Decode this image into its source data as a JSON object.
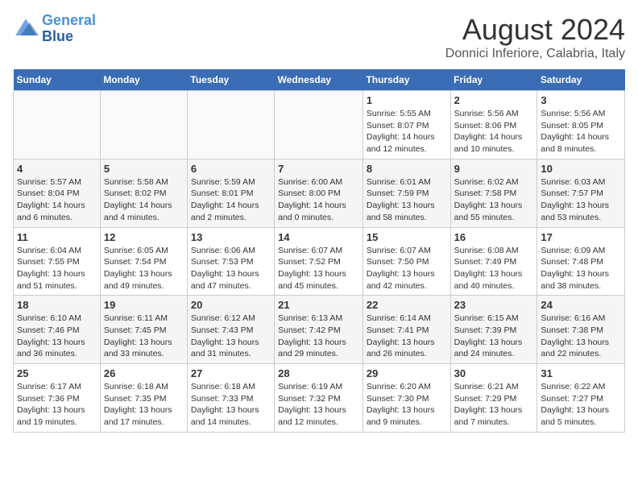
{
  "header": {
    "logo_line1": "General",
    "logo_line2": "Blue",
    "month_title": "August 2024",
    "location": "Donnici Inferiore, Calabria, Italy"
  },
  "weekdays": [
    "Sunday",
    "Monday",
    "Tuesday",
    "Wednesday",
    "Thursday",
    "Friday",
    "Saturday"
  ],
  "weeks": [
    [
      {
        "day": "",
        "info": ""
      },
      {
        "day": "",
        "info": ""
      },
      {
        "day": "",
        "info": ""
      },
      {
        "day": "",
        "info": ""
      },
      {
        "day": "1",
        "info": "Sunrise: 5:55 AM\nSunset: 8:07 PM\nDaylight: 14 hours\nand 12 minutes."
      },
      {
        "day": "2",
        "info": "Sunrise: 5:56 AM\nSunset: 8:06 PM\nDaylight: 14 hours\nand 10 minutes."
      },
      {
        "day": "3",
        "info": "Sunrise: 5:56 AM\nSunset: 8:05 PM\nDaylight: 14 hours\nand 8 minutes."
      }
    ],
    [
      {
        "day": "4",
        "info": "Sunrise: 5:57 AM\nSunset: 8:04 PM\nDaylight: 14 hours\nand 6 minutes."
      },
      {
        "day": "5",
        "info": "Sunrise: 5:58 AM\nSunset: 8:02 PM\nDaylight: 14 hours\nand 4 minutes."
      },
      {
        "day": "6",
        "info": "Sunrise: 5:59 AM\nSunset: 8:01 PM\nDaylight: 14 hours\nand 2 minutes."
      },
      {
        "day": "7",
        "info": "Sunrise: 6:00 AM\nSunset: 8:00 PM\nDaylight: 14 hours\nand 0 minutes."
      },
      {
        "day": "8",
        "info": "Sunrise: 6:01 AM\nSunset: 7:59 PM\nDaylight: 13 hours\nand 58 minutes."
      },
      {
        "day": "9",
        "info": "Sunrise: 6:02 AM\nSunset: 7:58 PM\nDaylight: 13 hours\nand 55 minutes."
      },
      {
        "day": "10",
        "info": "Sunrise: 6:03 AM\nSunset: 7:57 PM\nDaylight: 13 hours\nand 53 minutes."
      }
    ],
    [
      {
        "day": "11",
        "info": "Sunrise: 6:04 AM\nSunset: 7:55 PM\nDaylight: 13 hours\nand 51 minutes."
      },
      {
        "day": "12",
        "info": "Sunrise: 6:05 AM\nSunset: 7:54 PM\nDaylight: 13 hours\nand 49 minutes."
      },
      {
        "day": "13",
        "info": "Sunrise: 6:06 AM\nSunset: 7:53 PM\nDaylight: 13 hours\nand 47 minutes."
      },
      {
        "day": "14",
        "info": "Sunrise: 6:07 AM\nSunset: 7:52 PM\nDaylight: 13 hours\nand 45 minutes."
      },
      {
        "day": "15",
        "info": "Sunrise: 6:07 AM\nSunset: 7:50 PM\nDaylight: 13 hours\nand 42 minutes."
      },
      {
        "day": "16",
        "info": "Sunrise: 6:08 AM\nSunset: 7:49 PM\nDaylight: 13 hours\nand 40 minutes."
      },
      {
        "day": "17",
        "info": "Sunrise: 6:09 AM\nSunset: 7:48 PM\nDaylight: 13 hours\nand 38 minutes."
      }
    ],
    [
      {
        "day": "18",
        "info": "Sunrise: 6:10 AM\nSunset: 7:46 PM\nDaylight: 13 hours\nand 36 minutes."
      },
      {
        "day": "19",
        "info": "Sunrise: 6:11 AM\nSunset: 7:45 PM\nDaylight: 13 hours\nand 33 minutes."
      },
      {
        "day": "20",
        "info": "Sunrise: 6:12 AM\nSunset: 7:43 PM\nDaylight: 13 hours\nand 31 minutes."
      },
      {
        "day": "21",
        "info": "Sunrise: 6:13 AM\nSunset: 7:42 PM\nDaylight: 13 hours\nand 29 minutes."
      },
      {
        "day": "22",
        "info": "Sunrise: 6:14 AM\nSunset: 7:41 PM\nDaylight: 13 hours\nand 26 minutes."
      },
      {
        "day": "23",
        "info": "Sunrise: 6:15 AM\nSunset: 7:39 PM\nDaylight: 13 hours\nand 24 minutes."
      },
      {
        "day": "24",
        "info": "Sunrise: 6:16 AM\nSunset: 7:38 PM\nDaylight: 13 hours\nand 22 minutes."
      }
    ],
    [
      {
        "day": "25",
        "info": "Sunrise: 6:17 AM\nSunset: 7:36 PM\nDaylight: 13 hours\nand 19 minutes."
      },
      {
        "day": "26",
        "info": "Sunrise: 6:18 AM\nSunset: 7:35 PM\nDaylight: 13 hours\nand 17 minutes."
      },
      {
        "day": "27",
        "info": "Sunrise: 6:18 AM\nSunset: 7:33 PM\nDaylight: 13 hours\nand 14 minutes."
      },
      {
        "day": "28",
        "info": "Sunrise: 6:19 AM\nSunset: 7:32 PM\nDaylight: 13 hours\nand 12 minutes."
      },
      {
        "day": "29",
        "info": "Sunrise: 6:20 AM\nSunset: 7:30 PM\nDaylight: 13 hours\nand 9 minutes."
      },
      {
        "day": "30",
        "info": "Sunrise: 6:21 AM\nSunset: 7:29 PM\nDaylight: 13 hours\nand 7 minutes."
      },
      {
        "day": "31",
        "info": "Sunrise: 6:22 AM\nSunset: 7:27 PM\nDaylight: 13 hours\nand 5 minutes."
      }
    ]
  ]
}
